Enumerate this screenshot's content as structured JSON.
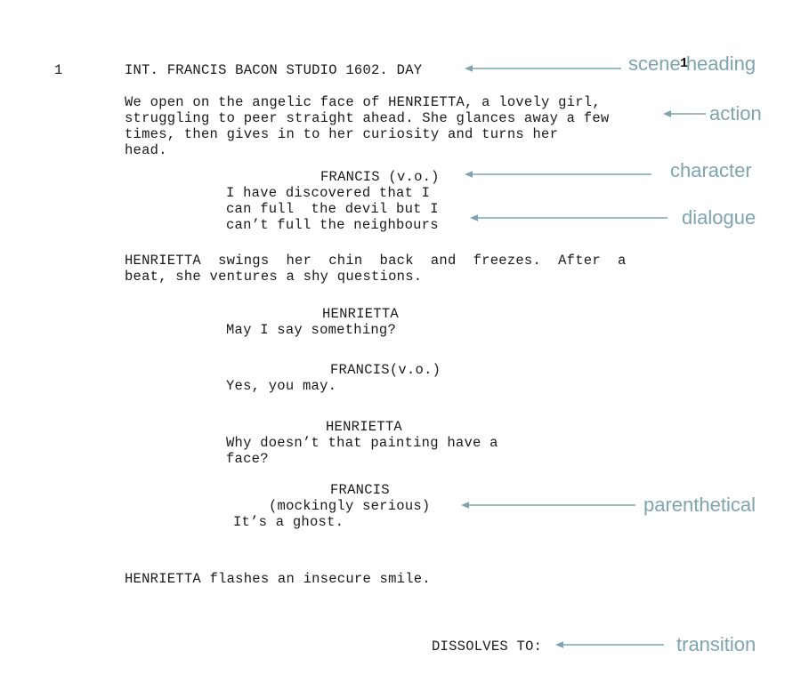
{
  "document": {
    "type": "screenplay-page",
    "page_number": "1",
    "scene_number": "1",
    "background_color": "#ffffff",
    "text_color": "#1a1a1a",
    "annotation_color": "#7ea4ad"
  },
  "script": {
    "scene_heading": "INT. FRANCIS BACON STUDIO 1602. DAY",
    "action_1": [
      "We open on the angelic face of HENRIETTA, a lovely girl,",
      "struggling to peer straight ahead. She glances away a few",
      "times, then gives in to her curiosity and turns her",
      "head."
    ],
    "character_1": "FRANCIS (v.o.)",
    "dialogue_1": [
      "I have discovered that I",
      "can full  the devil but I",
      "can’t full the neighbours"
    ],
    "action_2": [
      "HENRIETTA  swings  her  chin  back  and  freezes.  After  a",
      "beat, she ventures a shy questions."
    ],
    "character_2": "HENRIETTA",
    "dialogue_2": [
      "May I say something?"
    ],
    "character_3": "FRANCIS(v.o.)",
    "dialogue_3": [
      "Yes, you may."
    ],
    "character_4": "HENRIETTA",
    "dialogue_4": [
      "Why doesn’t that painting have a",
      "face?"
    ],
    "character_5": "FRANCIS",
    "parenthetical_1": "(mockingly serious)",
    "dialogue_5": [
      "It’s a ghost."
    ],
    "action_3": [
      "HENRIETTA flashes an insecure smile."
    ],
    "transition": "DISSOLVES TO:"
  },
  "annotations": [
    {
      "id": "scene-heading",
      "label": "scene heading"
    },
    {
      "id": "action",
      "label": "action"
    },
    {
      "id": "character",
      "label": "character"
    },
    {
      "id": "dialogue",
      "label": "dialogue"
    },
    {
      "id": "parenthetical",
      "label": "parenthetical"
    },
    {
      "id": "transition",
      "label": "transition"
    }
  ]
}
